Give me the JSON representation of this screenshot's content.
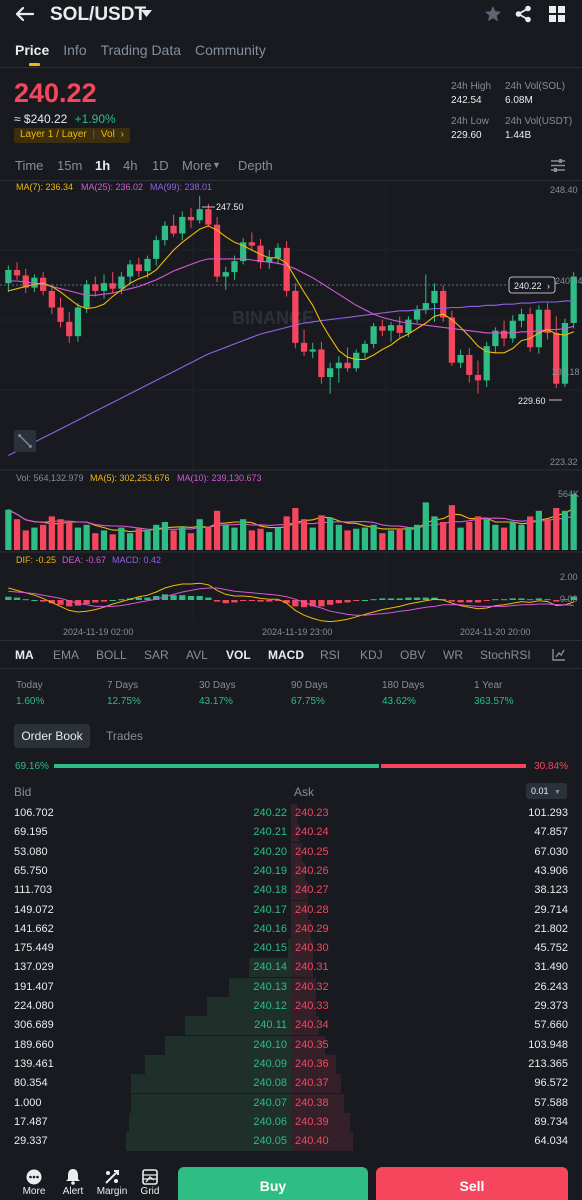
{
  "header": {
    "title": "SOL/USDT"
  },
  "nav_tabs": [
    "Price",
    "Info",
    "Trading Data",
    "Community"
  ],
  "ticker": {
    "last_price": "240.22",
    "approx": "≈ $240.22",
    "change": "+1.90%",
    "tag": "Layer 1 / Layer",
    "tag2": "Vol",
    "high_label": "24h High",
    "high": "242.54",
    "low_label": "24h Low",
    "low": "229.60",
    "vol_base_label": "24h Vol(SOL)",
    "vol_base": "6.08M",
    "vol_quote_label": "24h Vol(USDT)",
    "vol_quote": "1.44B"
  },
  "timeframes": [
    "Time",
    "15m",
    "1h",
    "4h",
    "1D",
    "More",
    "Depth"
  ],
  "chart": {
    "ma7": "MA(7): 236.34",
    "ma25": "MA(25): 236.02",
    "ma99": "MA(99): 238.01",
    "peak_label": "247.50",
    "low_label": "229.60",
    "current": "240.22",
    "axis": [
      "248.40",
      "240.04",
      "231.18",
      "223.32"
    ],
    "vol_text": "Vol: 564,132.979",
    "vol_ma5": "MA(5): 302,253.676",
    "vol_ma10": "MA(10): 239,130.673",
    "vol_axis": "564K",
    "macd_dif": "DIF: -0.25",
    "macd_dea": "DEA: -0.67",
    "macd_val": "MACD: 0.42",
    "macd_axis_top": "2.00",
    "macd_axis_zero": "0.00",
    "dates": [
      "2024-11-19 02:00",
      "2024-11-19 23:00",
      "2024-11-20 20:00"
    ],
    "watermark": "BINANCE",
    "colors": {
      "up": "#2ebd85",
      "down": "#f6465d",
      "ma7": "#f0b90b",
      "ma25": "#d757d6",
      "ma99": "#8e63e6"
    }
  },
  "indicators": [
    "MA",
    "EMA",
    "BOLL",
    "SAR",
    "AVL",
    "VOL",
    "MACD",
    "RSI",
    "KDJ",
    "OBV",
    "WR",
    "StochRSI"
  ],
  "performance": [
    {
      "label": "Today",
      "value": "1.60%"
    },
    {
      "label": "7 Days",
      "value": "12.75%"
    },
    {
      "label": "30 Days",
      "value": "43.17%"
    },
    {
      "label": "90 Days",
      "value": "67.75%"
    },
    {
      "label": "180 Days",
      "value": "43.62%"
    },
    {
      "label": "1 Year",
      "value": "363.57%"
    }
  ],
  "orderbook": {
    "tab_active": "Order Book",
    "tab_other": "Trades",
    "bid_ratio": "69.16%",
    "ask_ratio": "30.84%",
    "bid_fraction": 0.6916,
    "bid_label": "Bid",
    "ask_label": "Ask",
    "precision": "0.01",
    "rows": [
      {
        "bid_qty": "106.702",
        "bid": "240.22",
        "ask": "240.23",
        "ask_qty": "101.293",
        "bid_depth": 0.0,
        "ask_depth": 0.02
      },
      {
        "bid_qty": "69.195",
        "bid": "240.21",
        "ask": "240.24",
        "ask_qty": "47.857",
        "bid_depth": 0.0,
        "ask_depth": 0.03
      },
      {
        "bid_qty": "53.080",
        "bid": "240.20",
        "ask": "240.25",
        "ask_qty": "67.030",
        "bid_depth": 0.0,
        "ask_depth": 0.04
      },
      {
        "bid_qty": "65.750",
        "bid": "240.19",
        "ask": "240.26",
        "ask_qty": "43.906",
        "bid_depth": 0.0,
        "ask_depth": 0.05
      },
      {
        "bid_qty": "111.703",
        "bid": "240.18",
        "ask": "240.27",
        "ask_qty": "38.123",
        "bid_depth": 0.0,
        "ask_depth": 0.06
      },
      {
        "bid_qty": "149.072",
        "bid": "240.17",
        "ask": "240.28",
        "ask_qty": "29.714",
        "bid_depth": 0.0,
        "ask_depth": 0.06
      },
      {
        "bid_qty": "141.662",
        "bid": "240.16",
        "ask": "240.29",
        "ask_qty": "21.802",
        "bid_depth": 0.0,
        "ask_depth": 0.07
      },
      {
        "bid_qty": "175.449",
        "bid": "240.15",
        "ask": "240.30",
        "ask_qty": "45.752",
        "bid_depth": 0.01,
        "ask_depth": 0.08
      },
      {
        "bid_qty": "137.029",
        "bid": "240.14",
        "ask": "240.31",
        "ask_qty": "31.490",
        "bid_depth": 0.15,
        "ask_depth": 0.08
      },
      {
        "bid_qty": "191.407",
        "bid": "240.13",
        "ask": "240.32",
        "ask_qty": "26.243",
        "bid_depth": 0.22,
        "ask_depth": 0.09
      },
      {
        "bid_qty": "224.080",
        "bid": "240.12",
        "ask": "240.33",
        "ask_qty": "29.373",
        "bid_depth": 0.3,
        "ask_depth": 0.09
      },
      {
        "bid_qty": "306.689",
        "bid": "240.11",
        "ask": "240.34",
        "ask_qty": "57.660",
        "bid_depth": 0.38,
        "ask_depth": 0.1
      },
      {
        "bid_qty": "189.660",
        "bid": "240.10",
        "ask": "240.35",
        "ask_qty": "103.948",
        "bid_depth": 0.45,
        "ask_depth": 0.12
      },
      {
        "bid_qty": "139.461",
        "bid": "240.09",
        "ask": "240.36",
        "ask_qty": "213.365",
        "bid_depth": 0.52,
        "ask_depth": 0.16
      },
      {
        "bid_qty": "80.354",
        "bid": "240.08",
        "ask": "240.37",
        "ask_qty": "96.572",
        "bid_depth": 0.57,
        "ask_depth": 0.18
      },
      {
        "bid_qty": "1.000",
        "bid": "240.07",
        "ask": "240.38",
        "ask_qty": "57.588",
        "bid_depth": 0.57,
        "ask_depth": 0.19
      },
      {
        "bid_qty": "17.487",
        "bid": "240.06",
        "ask": "240.39",
        "ask_qty": "89.734",
        "bid_depth": 0.58,
        "ask_depth": 0.21
      },
      {
        "bid_qty": "29.337",
        "bid": "240.05",
        "ask": "240.40",
        "ask_qty": "64.034",
        "bid_depth": 0.59,
        "ask_depth": 0.22
      }
    ]
  },
  "bottom_bar": {
    "items": [
      {
        "label": "More",
        "icon": "more-dots-icon"
      },
      {
        "label": "Alert",
        "icon": "bell-icon"
      },
      {
        "label": "Margin",
        "icon": "margin-icon"
      },
      {
        "label": "Grid",
        "icon": "grid-bot-icon"
      }
    ],
    "buy": "Buy",
    "sell": "Sell"
  },
  "chart_data": {
    "type": "candlestick",
    "ylim": [
      223.32,
      248.4
    ],
    "candles": [
      [
        239.6,
        241.2,
        238.8,
        240.8
      ],
      [
        240.8,
        241.5,
        239.9,
        240.3
      ],
      [
        240.3,
        240.9,
        238.7,
        239.2
      ],
      [
        239.2,
        240.4,
        238.8,
        240.1
      ],
      [
        240.1,
        240.6,
        238.5,
        238.9
      ],
      [
        238.9,
        239.5,
        236.8,
        237.4
      ],
      [
        237.4,
        238.3,
        235.6,
        236.1
      ],
      [
        236.1,
        237.0,
        234.2,
        234.8
      ],
      [
        234.8,
        237.8,
        234.3,
        237.4
      ],
      [
        237.4,
        239.9,
        236.9,
        239.5
      ],
      [
        239.5,
        240.2,
        238.4,
        238.9
      ],
      [
        238.9,
        240.4,
        238.2,
        239.6
      ],
      [
        239.6,
        240.6,
        238.7,
        239.1
      ],
      [
        239.1,
        240.6,
        238.6,
        240.2
      ],
      [
        240.2,
        241.7,
        239.5,
        241.3
      ],
      [
        241.3,
        241.9,
        240.2,
        240.7
      ],
      [
        240.7,
        242.1,
        240.1,
        241.8
      ],
      [
        241.8,
        243.9,
        241.2,
        243.5
      ],
      [
        243.5,
        245.2,
        243.0,
        244.8
      ],
      [
        244.8,
        245.8,
        243.8,
        244.1
      ],
      [
        244.1,
        246.1,
        243.5,
        245.6
      ],
      [
        245.6,
        246.4,
        244.6,
        245.3
      ],
      [
        245.3,
        247.5,
        245.0,
        246.3
      ],
      [
        246.3,
        246.8,
        244.7,
        244.9
      ],
      [
        244.9,
        245.6,
        239.7,
        240.2
      ],
      [
        240.2,
        241.1,
        239.0,
        240.6
      ],
      [
        240.6,
        242.1,
        239.9,
        241.6
      ],
      [
        241.6,
        243.7,
        241.3,
        243.3
      ],
      [
        243.3,
        244.2,
        242.6,
        243.0
      ],
      [
        243.0,
        243.6,
        240.9,
        241.5
      ],
      [
        241.5,
        242.6,
        240.9,
        241.9
      ],
      [
        241.9,
        243.2,
        241.3,
        242.8
      ],
      [
        242.8,
        243.4,
        238.4,
        238.9
      ],
      [
        238.9,
        239.6,
        233.7,
        234.2
      ],
      [
        234.2,
        235.4,
        233.0,
        233.4
      ],
      [
        233.4,
        234.2,
        232.8,
        233.6
      ],
      [
        233.6,
        234.3,
        230.5,
        231.1
      ],
      [
        231.1,
        232.4,
        229.6,
        231.9
      ],
      [
        231.9,
        233.0,
        230.6,
        232.4
      ],
      [
        232.4,
        233.8,
        231.6,
        231.9
      ],
      [
        231.9,
        233.6,
        231.6,
        233.3
      ],
      [
        233.3,
        234.4,
        232.8,
        234.1
      ],
      [
        234.1,
        236.0,
        233.7,
        235.7
      ],
      [
        235.7,
        236.3,
        234.8,
        235.3
      ],
      [
        235.3,
        236.1,
        234.3,
        235.8
      ],
      [
        235.8,
        236.6,
        234.7,
        235.1
      ],
      [
        235.1,
        236.6,
        234.7,
        236.3
      ],
      [
        236.3,
        237.6,
        236.0,
        237.2
      ],
      [
        237.2,
        240.4,
        236.8,
        237.8
      ],
      [
        237.8,
        239.6,
        236.1,
        238.9
      ],
      [
        238.9,
        239.4,
        236.1,
        236.5
      ],
      [
        236.5,
        237.1,
        232.1,
        232.4
      ],
      [
        232.4,
        233.6,
        231.9,
        233.1
      ],
      [
        233.1,
        233.7,
        230.6,
        231.3
      ],
      [
        231.3,
        232.6,
        229.6,
        230.8
      ],
      [
        230.8,
        234.3,
        230.2,
        233.9
      ],
      [
        233.9,
        235.6,
        233.3,
        235.3
      ],
      [
        235.3,
        236.2,
        233.9,
        234.6
      ],
      [
        234.6,
        236.7,
        234.2,
        236.2
      ],
      [
        236.2,
        237.3,
        235.6,
        236.8
      ],
      [
        236.8,
        237.4,
        233.4,
        233.8
      ],
      [
        233.8,
        237.6,
        233.2,
        237.2
      ],
      [
        237.2,
        237.8,
        234.5,
        235.1
      ],
      [
        235.1,
        236.6,
        230.1,
        230.5
      ],
      [
        230.5,
        236.4,
        230.2,
        236.0
      ],
      [
        236.0,
        240.6,
        235.5,
        240.2
      ]
    ],
    "ma7": [
      238.9,
      239.1,
      239.3,
      239.5,
      239.6,
      239.3,
      238.8,
      238.2,
      237.6,
      237.3,
      237.4,
      237.7,
      238.4,
      239.0,
      239.6,
      240.0,
      240.3,
      240.8,
      241.7,
      242.6,
      243.3,
      243.9,
      244.5,
      244.8,
      244.4,
      243.8,
      243.3,
      243.0,
      242.6,
      242.2,
      241.9,
      241.9,
      241.4,
      240.1,
      238.8,
      237.6,
      236.0,
      234.7,
      233.5,
      232.9,
      232.7,
      232.7,
      233.1,
      233.6,
      234.0,
      234.6,
      235.0,
      235.5,
      236.0,
      236.6,
      236.8,
      236.3,
      235.6,
      234.8,
      233.9,
      233.4,
      233.3,
      233.3,
      233.7,
      234.4,
      234.6,
      235.1,
      235.4,
      235.0,
      234.9,
      235.2
    ],
    "ma25": [
      239.8,
      239.8,
      239.7,
      239.6,
      239.5,
      239.3,
      239.1,
      238.9,
      238.7,
      238.5,
      238.5,
      238.6,
      238.7,
      238.9,
      239.1,
      239.3,
      239.6,
      239.9,
      240.3,
      240.7,
      241.0,
      241.3,
      241.6,
      241.8,
      241.8,
      241.8,
      241.8,
      241.8,
      241.7,
      241.6,
      241.5,
      241.4,
      241.2,
      240.9,
      240.5,
      240.1,
      239.6,
      239.1,
      238.6,
      238.1,
      237.6,
      237.2,
      236.8,
      236.5,
      236.3,
      236.1,
      236.0,
      235.9,
      235.8,
      235.7,
      235.6,
      235.5,
      235.4,
      235.3,
      235.2,
      235.1,
      235.1,
      235.1,
      235.1,
      235.2,
      235.2,
      235.3,
      235.4,
      235.4,
      235.5,
      235.7
    ],
    "ma99": [
      224.0,
      224.4,
      224.8,
      225.2,
      225.6,
      226.0,
      226.4,
      226.8,
      227.2,
      227.6,
      228.0,
      228.4,
      228.8,
      229.2,
      229.6,
      230.0,
      230.4,
      230.8,
      231.2,
      231.6,
      232.0,
      232.4,
      232.8,
      233.2,
      233.5,
      233.8,
      234.1,
      234.4,
      234.7,
      235.0,
      235.2,
      235.4,
      235.6,
      235.8,
      236.0,
      236.1,
      236.2,
      236.3,
      236.4,
      236.5,
      236.6,
      236.7,
      236.8,
      236.9,
      237.0,
      237.1,
      237.1,
      237.2,
      237.2,
      237.3,
      237.3,
      237.4,
      237.4,
      237.5,
      237.5,
      237.6,
      237.6,
      237.7,
      237.7,
      237.8,
      237.8,
      237.9,
      237.9,
      237.9,
      238.0,
      238.0
    ],
    "volumes": [
      0.72,
      0.55,
      0.35,
      0.4,
      0.45,
      0.6,
      0.55,
      0.5,
      0.4,
      0.45,
      0.3,
      0.35,
      0.28,
      0.4,
      0.3,
      0.38,
      0.36,
      0.45,
      0.5,
      0.35,
      0.42,
      0.3,
      0.55,
      0.4,
      0.7,
      0.45,
      0.4,
      0.55,
      0.35,
      0.38,
      0.32,
      0.4,
      0.6,
      0.75,
      0.55,
      0.4,
      0.62,
      0.58,
      0.45,
      0.35,
      0.38,
      0.4,
      0.45,
      0.3,
      0.35,
      0.38,
      0.4,
      0.45,
      0.85,
      0.6,
      0.5,
      0.8,
      0.4,
      0.5,
      0.6,
      0.55,
      0.45,
      0.4,
      0.5,
      0.45,
      0.6,
      0.7,
      0.55,
      0.75,
      0.7,
      1.0
    ],
    "macd_hist": [
      0.4,
      0.3,
      0.1,
      0.0,
      -0.2,
      -0.4,
      -0.6,
      -0.8,
      -0.7,
      -0.5,
      -0.3,
      -0.2,
      0.0,
      0.1,
      0.2,
      0.3,
      0.3,
      0.5,
      0.7,
      0.6,
      0.6,
      0.5,
      0.5,
      0.3,
      -0.2,
      -0.4,
      -0.3,
      -0.1,
      -0.1,
      -0.2,
      -0.2,
      -0.1,
      -0.4,
      -0.8,
      -0.9,
      -0.8,
      -0.8,
      -0.6,
      -0.4,
      -0.3,
      -0.1,
      0.0,
      0.1,
      0.2,
      0.2,
      0.2,
      0.3,
      0.3,
      0.3,
      0.3,
      0.1,
      -0.2,
      -0.3,
      -0.3,
      -0.3,
      -0.1,
      0.1,
      0.1,
      0.2,
      0.2,
      0.1,
      0.2,
      0.1,
      -0.2,
      0.1,
      0.42
    ],
    "dif": [
      1.5,
      1.2,
      0.9,
      0.6,
      0.2,
      -0.3,
      -0.8,
      -1.3,
      -1.5,
      -1.4,
      -1.2,
      -0.9,
      -0.5,
      -0.2,
      0.1,
      0.4,
      0.6,
      1.0,
      1.5,
      1.8,
      2.0,
      2.0,
      2.1,
      1.9,
      1.2,
      0.7,
      0.5,
      0.5,
      0.4,
      0.2,
      0.1,
      0.1,
      -0.4,
      -1.3,
      -1.9,
      -2.3,
      -2.6,
      -2.7,
      -2.6,
      -2.4,
      -2.1,
      -1.8,
      -1.5,
      -1.2,
      -1.0,
      -0.8,
      -0.5,
      -0.3,
      -0.1,
      0.1,
      0.0,
      -0.4,
      -0.7,
      -0.9,
      -1.1,
      -1.0,
      -0.7,
      -0.6,
      -0.4,
      -0.2,
      -0.3,
      -0.1,
      -0.2,
      -0.7,
      -0.6,
      -0.25
    ],
    "dea": [
      1.1,
      1.0,
      0.9,
      0.8,
      0.6,
      0.4,
      0.2,
      -0.1,
      -0.4,
      -0.6,
      -0.8,
      -0.8,
      -0.8,
      -0.7,
      -0.5,
      -0.3,
      -0.1,
      0.1,
      0.4,
      0.7,
      1.0,
      1.2,
      1.4,
      1.5,
      1.5,
      1.3,
      1.1,
      1.0,
      0.9,
      0.8,
      0.7,
      0.6,
      0.4,
      0.1,
      -0.3,
      -0.7,
      -1.0,
      -1.4,
      -1.6,
      -1.8,
      -1.9,
      -1.9,
      -1.8,
      -1.7,
      -1.6,
      -1.4,
      -1.3,
      -1.1,
      -0.9,
      -0.8,
      -0.6,
      -0.6,
      -0.6,
      -0.7,
      -0.8,
      -0.8,
      -0.8,
      -0.8,
      -0.7,
      -0.6,
      -0.6,
      -0.5,
      -0.5,
      -0.6,
      -0.6,
      -0.67
    ]
  }
}
